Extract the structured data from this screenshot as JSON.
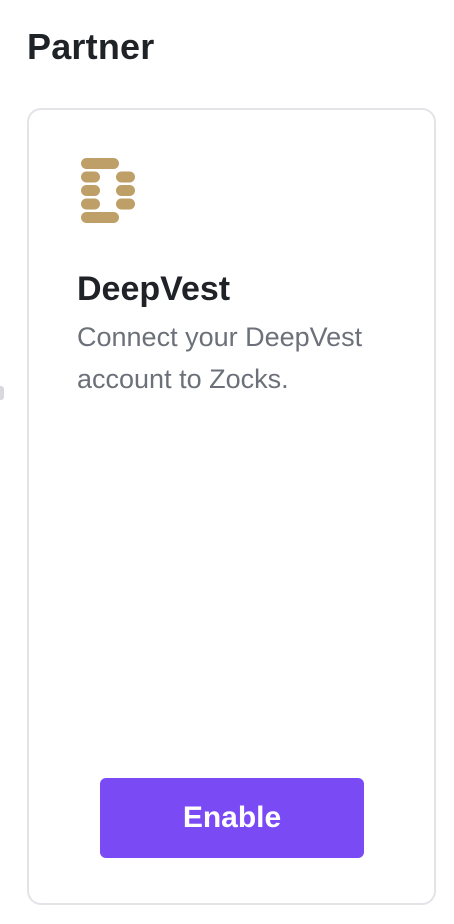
{
  "section": {
    "title": "Partner"
  },
  "partner": {
    "logo_icon": "deepvest-logo-icon",
    "name": "DeepVest",
    "description": "Connect your DeepVest account to Zocks.",
    "button_label": "Enable"
  },
  "colors": {
    "accent": "#7a4af5",
    "logo_gold": "#bd9f67",
    "title_text": "#1f2227",
    "body_text": "#6b7079",
    "card_border": "#e3e4e8"
  }
}
